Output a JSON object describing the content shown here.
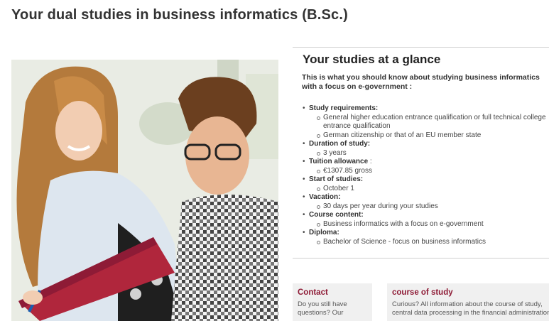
{
  "page": {
    "title": "Your dual studies in business informatics (B.Sc.)"
  },
  "glance": {
    "title": "Your studies at a glance",
    "intro": "This is what you should know about studying business informatics with a focus on e-government :",
    "items": [
      {
        "label": "Study requirements:",
        "details": [
          "General higher education entrance qualification or full technical college entrance qualification",
          "German citizenship or that of an EU member state"
        ]
      },
      {
        "label": "Duration of study:",
        "details": [
          "3 years"
        ]
      },
      {
        "label": "Tuition allowance",
        "label_suffix": " :",
        "details": [
          "€1307.85 gross"
        ]
      },
      {
        "label": "Start of studies:",
        "details": [
          "October 1"
        ]
      },
      {
        "label": "Vacation:",
        "details": [
          "30 days per year during your studies"
        ]
      },
      {
        "label": "Course content:",
        "details": [
          "Business informatics with a focus on e-government"
        ]
      },
      {
        "label": "Diploma:",
        "details": [
          "Bachelor of Science - focus on business informatics"
        ]
      }
    ]
  },
  "cards": {
    "contact": {
      "title": "Contact",
      "text_line1": "Do you still have",
      "text_line2": "questions? Our"
    },
    "course": {
      "title": "course of study",
      "text_line1": "Curious? All information about the course of study,",
      "text_line2": "central data processing in the financial administration"
    }
  },
  "colors": {
    "accent": "#8e1b36",
    "card_bg": "#f0f0f0",
    "folder": "#b0263c"
  }
}
